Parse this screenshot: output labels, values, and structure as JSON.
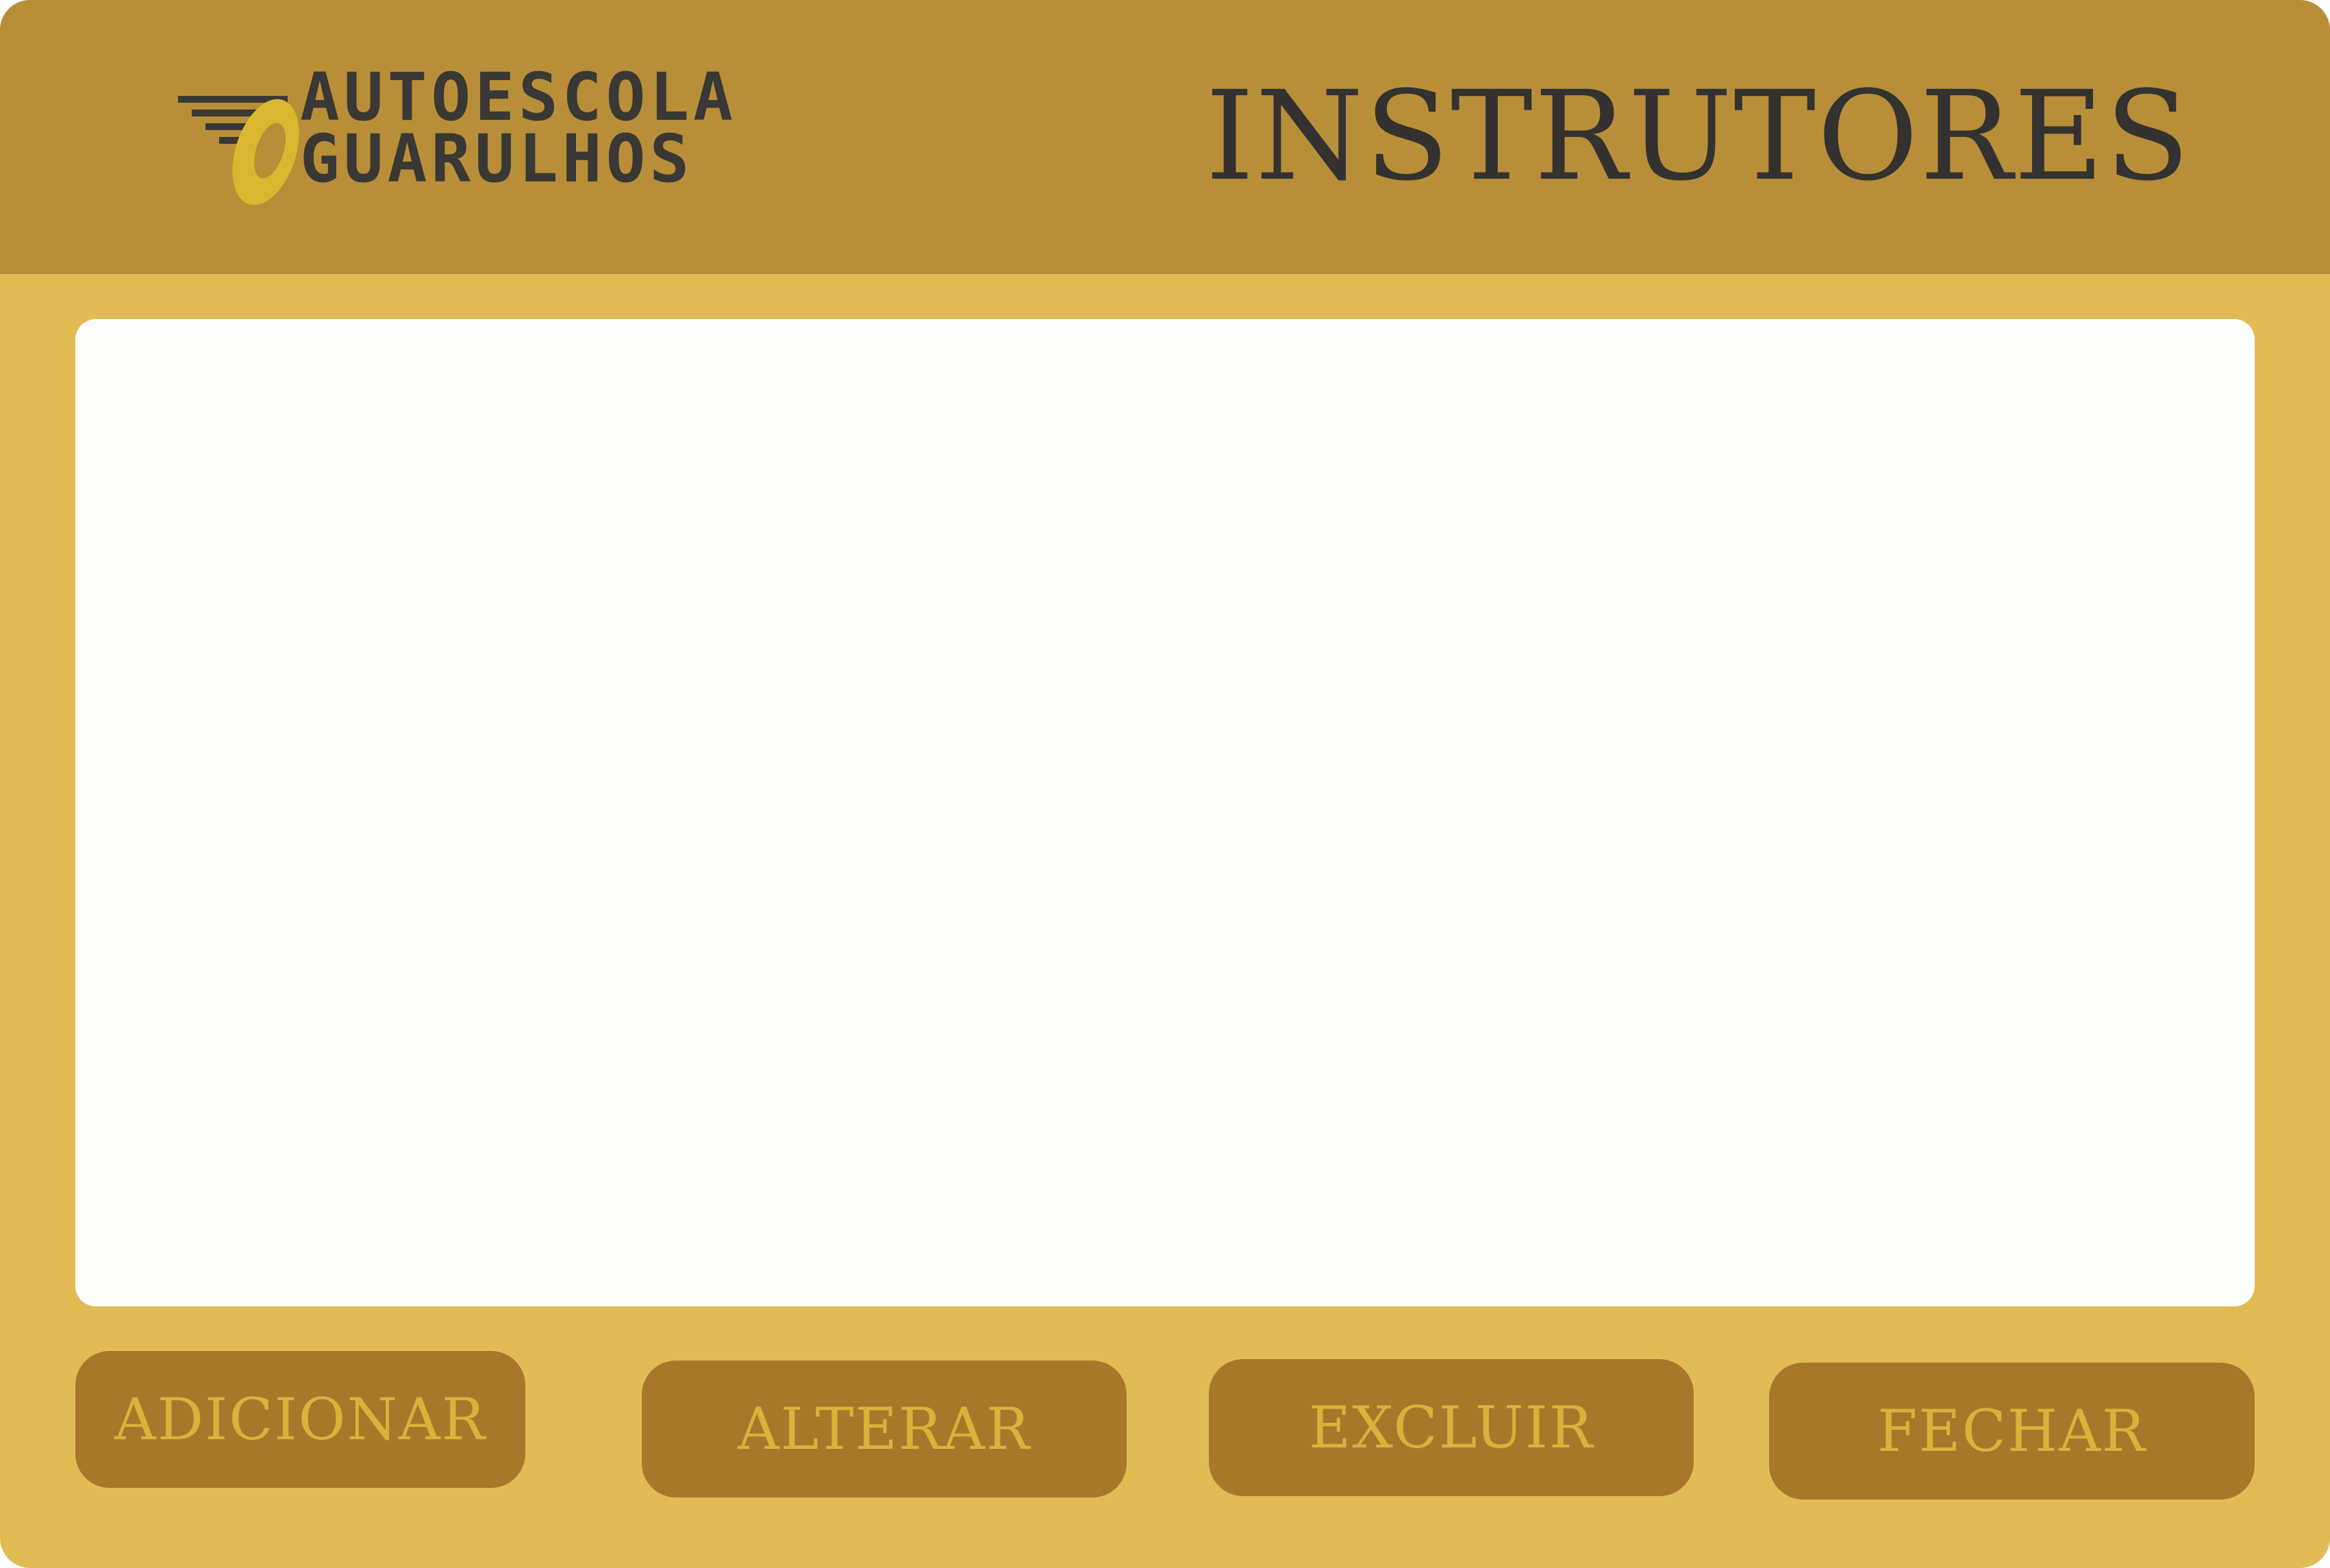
{
  "header": {
    "logo": {
      "line1": "AUTOESCOLA",
      "line2": "GUARULHOS"
    },
    "title": "INSTRUTORES"
  },
  "buttons": {
    "add": "ADICIONAR",
    "edit": "ALTERAR",
    "delete": "EXCLUIR",
    "close": "FECHAR"
  },
  "colors": {
    "window_bg": "#e1bc55",
    "header_bg": "#b88e38",
    "panel_bg": "#fdfdfb",
    "button_bg": "#a8782a",
    "button_text": "#d9b23a",
    "title_text": "#333231"
  }
}
